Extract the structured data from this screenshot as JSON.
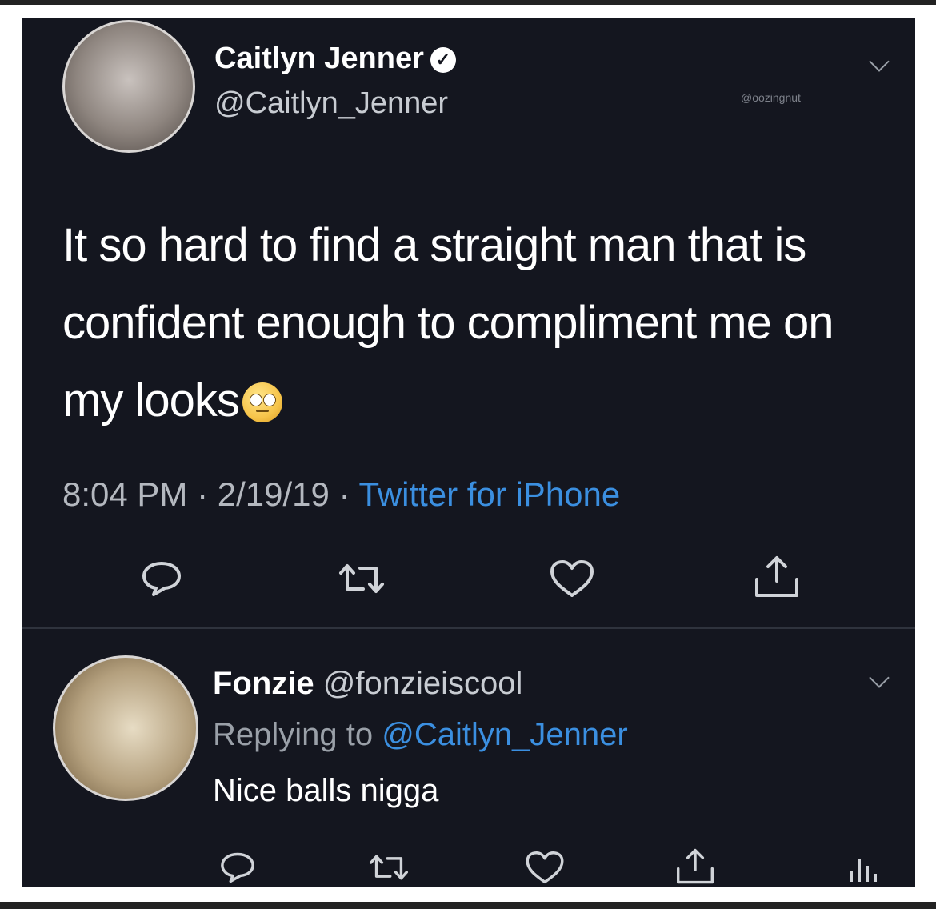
{
  "tweet": {
    "author_name": "Caitlyn Jenner",
    "verified_glyph": "✓",
    "author_handle": "@Caitlyn_Jenner",
    "watermark": "@oozingnut",
    "text": "It so hard to find a straight man that is confident enough to compliment me on my looks",
    "emoji": "face-with-rolling-eyes",
    "timestamp": "8:04 PM · 2/19/19 · ",
    "source": "Twitter for iPhone"
  },
  "reply": {
    "author_name": "Fonzie",
    "author_handle": "@fonzieiscool",
    "replying_prefix": "Replying to ",
    "replying_to": "@Caitlyn_Jenner",
    "text": "Nice balls nigga"
  },
  "icons": [
    "reply-icon",
    "retweet-icon",
    "like-icon",
    "share-icon",
    "analytics-icon",
    "chevron-down-icon",
    "verified-icon"
  ],
  "colors": {
    "background": "#14161f",
    "text": "#ffffff",
    "secondary_text": "#c8ccd2",
    "link": "#3b8fe0"
  }
}
